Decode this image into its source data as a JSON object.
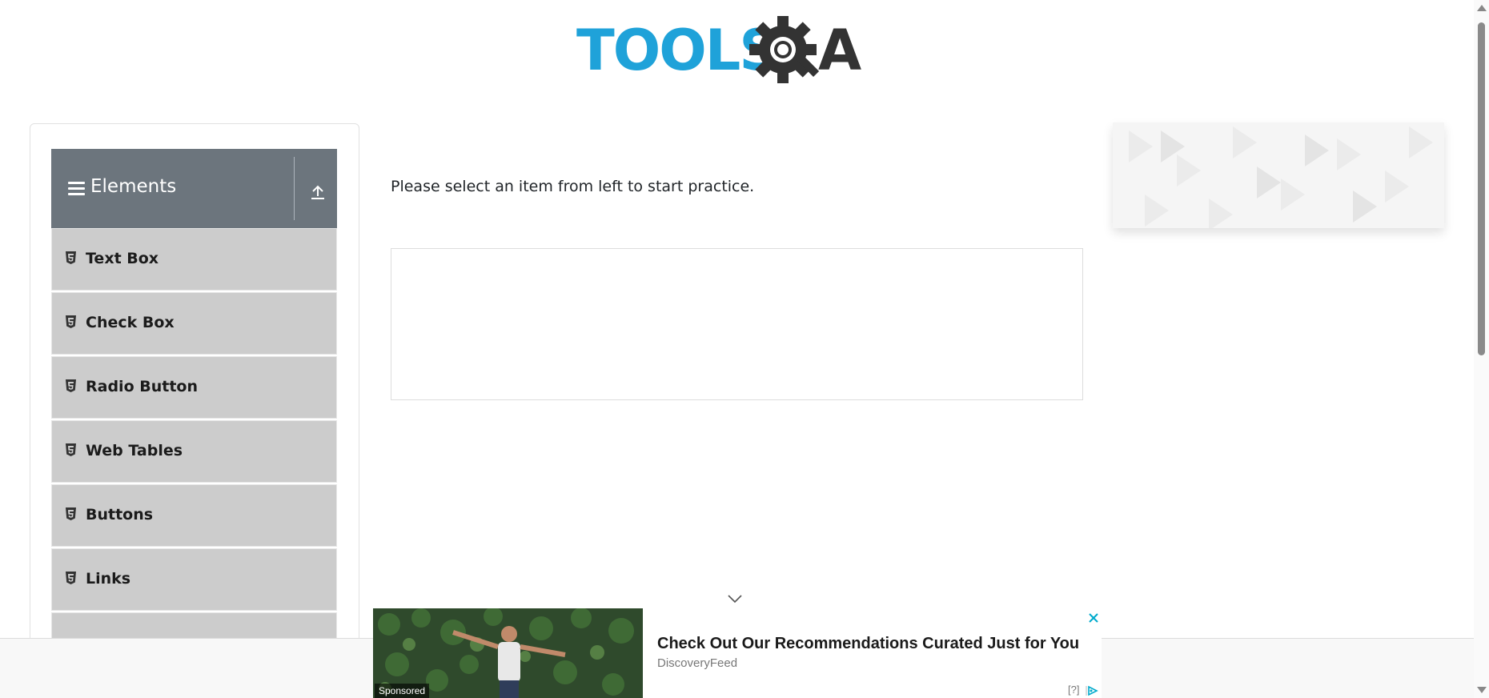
{
  "header": {
    "logo_text_left": "TOOLS",
    "logo_text_right": "A"
  },
  "sidebar": {
    "group": {
      "title": "Elements"
    },
    "items": [
      {
        "label": "Text Box"
      },
      {
        "label": "Check Box"
      },
      {
        "label": "Radio Button"
      },
      {
        "label": "Web Tables"
      },
      {
        "label": "Buttons"
      },
      {
        "label": "Links"
      },
      {
        "label": ""
      }
    ]
  },
  "main": {
    "instruction": "Please select an item from left to start practice."
  },
  "bottom_ad": {
    "sponsored_label": "Sponsored",
    "headline": "Check Out Our Recommendations Curated Just for You",
    "source": "DiscoveryFeed",
    "help_label": "[?]"
  },
  "colors": {
    "logo_blue": "#1fa2d9",
    "logo_dark": "#333333",
    "group_header_bg": "#6c757d",
    "menu_item_bg": "#cccccc",
    "close_teal": "#00aacc"
  },
  "icons": {
    "group_menu": "hamburger-icon",
    "group_toggle": "upload-icon",
    "item": "html5-icon",
    "collapse": "chevron-down-icon",
    "close": "close-icon",
    "adchoices": "adchoices-icon"
  }
}
